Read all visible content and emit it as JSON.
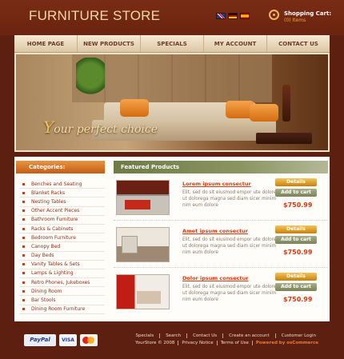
{
  "header": {
    "logo": "FURNITURE STORE",
    "languages": [
      "gb-flag",
      "de-flag",
      "es-flag"
    ],
    "cart_title": "Shopping Cart:",
    "cart_items": "(0) Items"
  },
  "nav": {
    "items": [
      "HOME PAGE",
      "NEW PRODUCTS",
      "SPECIALS",
      "MY ACCOUNT",
      "CONTACT US"
    ]
  },
  "banner": {
    "tagline_first": "Y",
    "tagline_rest": "our perfect  choice"
  },
  "sidebar": {
    "title": "Categories:",
    "items": [
      "Benches and Seating",
      "Blanket Racks",
      "Nesting Tables",
      "Other Accent Pieces",
      "Bathroom Furniture",
      "Racks & Cabinets",
      "Bedroom Furniture",
      "Canopy Bed",
      "Day Beds",
      "Vanity Tables & Sets",
      "Lamps & Lighting",
      "Retro Phones, Jukeboxes",
      "Dining Room",
      "Bar Stools",
      "Dining Room Furniture"
    ]
  },
  "products": {
    "title": "Featured Products",
    "items": [
      {
        "name": "Lorem ipsum consectur",
        "description": "Elit, sed do sit eiusmod empor ute dolore ut dolorega magna sed diam sicer minim nim eum dolore",
        "details_label": "Details",
        "cart_label": "Add to cart",
        "price": "$750.99"
      },
      {
        "name": "Amet ipsum consectur",
        "description": "Elit, sed do sit eiusmod empor ute dolore ut dolorega magna sed diam sicer minim nim eum dolore",
        "details_label": "Details",
        "cart_label": "Add to cart",
        "price": "$750.99"
      },
      {
        "name": "Dolor ipsum consectur",
        "description": "Elit, sed do sit eiusmod empor ute dolore ut dolorega magna sed diam sicer minim nim eum dolore",
        "details_label": "Details",
        "cart_label": "Add to cart",
        "price": "$750.99"
      }
    ]
  },
  "footer": {
    "payment": {
      "paypal": "PayPal",
      "visa": "VISA",
      "mastercard": "mastercard-icon"
    },
    "links": [
      "Specials",
      "Search",
      "Contact Us",
      "Create an account",
      "Customer Login"
    ],
    "copyright": "YourStore © 2008",
    "privacy": "Privacy Notice",
    "terms": "Terms of Use",
    "powered": "Powered by osCommerce"
  },
  "colors": {
    "background": "#5c1f10",
    "accent": "#d43c10",
    "category_header": "#c35e16",
    "products_header": "#6e7b45"
  }
}
